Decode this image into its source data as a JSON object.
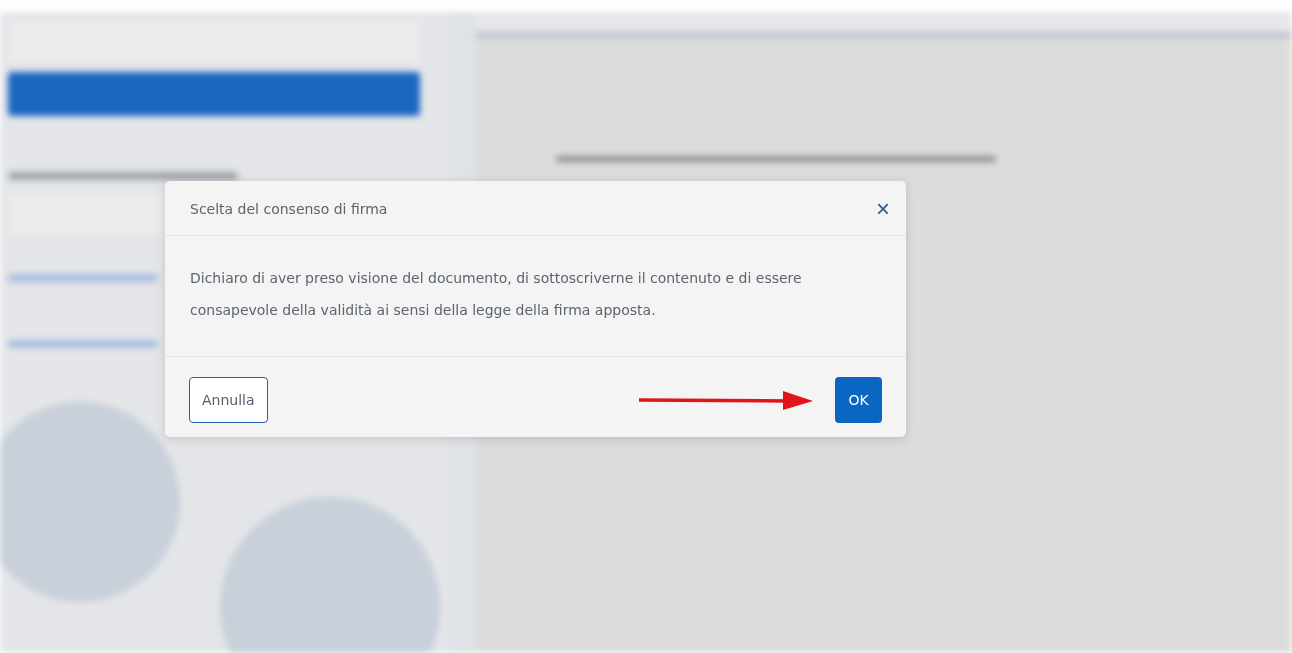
{
  "dialog": {
    "title": "Scelta del consenso di firma",
    "close_label": "×",
    "message": "Dichiaro di aver preso visione del documento, di sottoscriverne il contenuto e di essere consapevole della validità ai sensi della legge della firma apposta.",
    "buttons": [
      {
        "label": "Annulla",
        "kind": "secondary"
      },
      {
        "label": "OK",
        "kind": "primary"
      }
    ]
  }
}
